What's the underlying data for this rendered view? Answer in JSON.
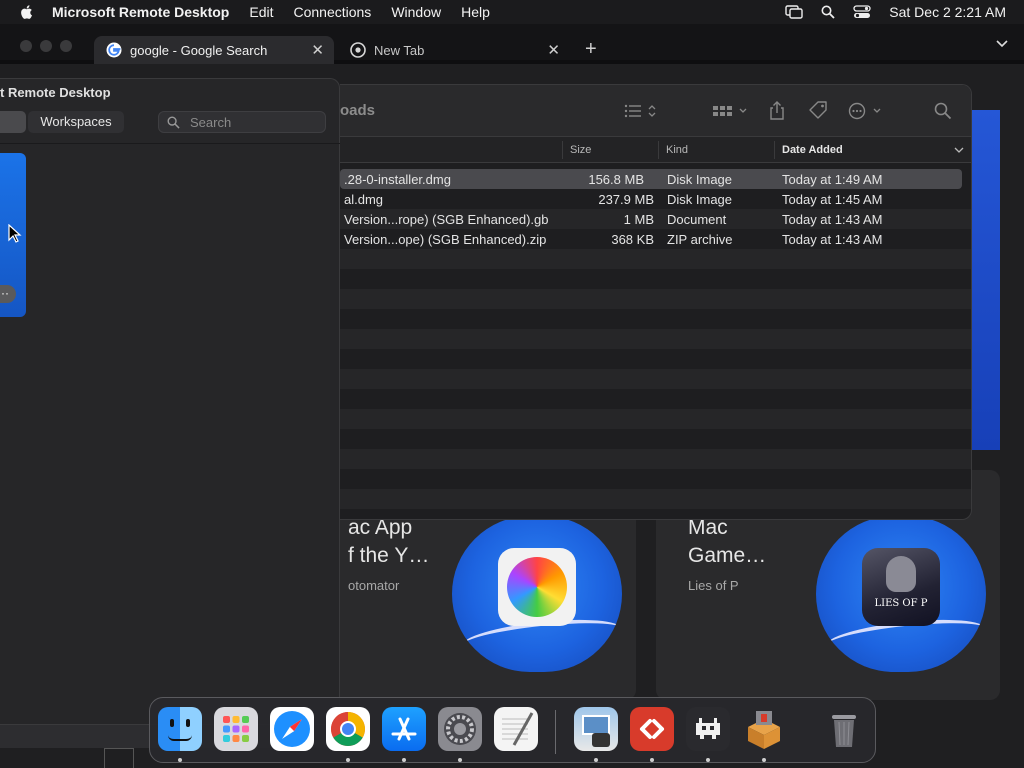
{
  "menubar": {
    "app_name": "Microsoft Remote Desktop",
    "items": [
      "Edit",
      "Connections",
      "Window",
      "Help"
    ],
    "datetime": "Sat Dec 2  2:21 AM"
  },
  "browser": {
    "tabs": [
      {
        "label": "google - Google Search",
        "active": true
      },
      {
        "label": "New Tab",
        "active": false
      }
    ],
    "new_tab_label": "+"
  },
  "remote_desktop": {
    "title": "t Remote Desktop",
    "workspaces_label": "Workspaces",
    "search_placeholder": "Search",
    "more_label": "···"
  },
  "finder": {
    "title": "oads",
    "columns": {
      "size": "Size",
      "kind": "Kind",
      "date_added": "Date Added"
    },
    "files": [
      {
        "name": ".28-0-installer.dmg",
        "size": "156.8 MB",
        "kind": "Disk Image",
        "date": "Today at 1:49 AM",
        "selected": true
      },
      {
        "name": "al.dmg",
        "size": "237.9 MB",
        "kind": "Disk Image",
        "date": "Today at 1:45 AM",
        "selected": false
      },
      {
        "name": " Version...rope) (SGB Enhanced).gb",
        "size": "1 MB",
        "kind": "Document",
        "date": "Today at 1:43 AM",
        "selected": false
      },
      {
        "name": " Version...ope) (SGB Enhanced).zip",
        "size": "368 KB",
        "kind": "ZIP archive",
        "date": "Today at 1:43 AM",
        "selected": false
      }
    ]
  },
  "app_store_cards": [
    {
      "title": "ac App\nf the Y…",
      "subtitle": "otomator"
    },
    {
      "title": "Mac\nGame…",
      "subtitle": "Lies of P"
    }
  ],
  "badge_text": "LIES OF P",
  "dock": {
    "apps": [
      "Finder",
      "Launchpad",
      "Safari",
      "Chrome",
      "App Store",
      "System Settings",
      "TextEdit",
      "Preview",
      "Remote Desktop",
      "RetroArch",
      "Archive Utility",
      "Trash"
    ]
  },
  "colors": {
    "accent_blue": "#1d63e0",
    "selection": "#4a4a4e"
  }
}
